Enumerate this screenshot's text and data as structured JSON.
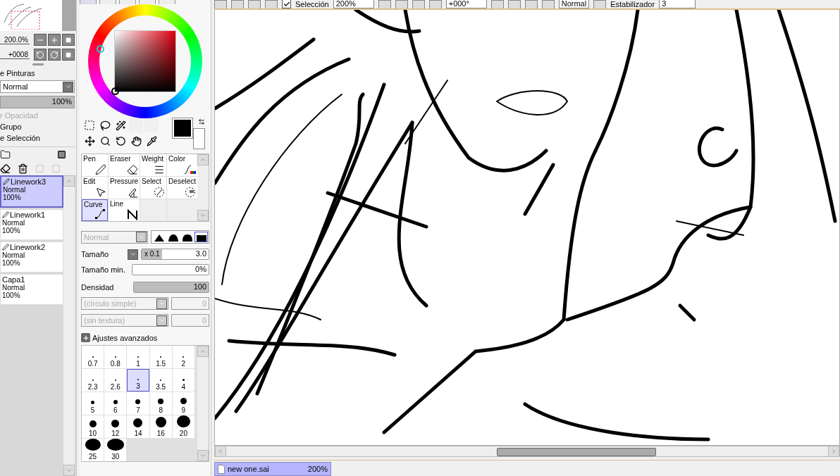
{
  "navigator": {
    "zoom": "200.0%",
    "rotation": "+0008"
  },
  "layer_panel": {
    "section_label": "e Pinturas",
    "blend_mode": "Normal",
    "opacity": {
      "text": "100%",
      "level": 1
    },
    "options": [
      {
        "label": "r Opacidad",
        "disabled": true
      },
      {
        "label": "Grupo",
        "disabled": false
      },
      {
        "label": "e Selección",
        "disabled": false
      }
    ]
  },
  "layers": [
    {
      "kind": "pen",
      "name": "Linework3",
      "mode": "Normal",
      "opacity": "100%",
      "selected": true
    },
    {
      "kind": "pen",
      "name": "Linework1",
      "mode": "Normal",
      "opacity": "100%",
      "selected": false
    },
    {
      "kind": "pen",
      "name": "Linework2",
      "mode": "Normal",
      "opacity": "100%",
      "selected": false
    },
    {
      "kind": "plain",
      "name": "Capa1",
      "mode": "Normal",
      "opacity": "100%",
      "selected": false
    }
  ],
  "tool_grid": [
    {
      "kind": "pen",
      "label": "Pen",
      "selected": false
    },
    {
      "kind": "eraser",
      "label": "Eraser",
      "selected": false
    },
    {
      "kind": "weight",
      "label": "Weight",
      "selected": false
    },
    {
      "kind": "color",
      "label": "Color",
      "selected": false
    },
    {
      "kind": "edit",
      "label": "Edit",
      "selected": false
    },
    {
      "kind": "pressure",
      "label": "Pressure",
      "selected": false
    },
    {
      "kind": "select",
      "label": "Select",
      "selected": false
    },
    {
      "kind": "deselect",
      "label": "Deselect",
      "selected": false
    },
    {
      "kind": "curve",
      "label": "Curve",
      "selected": true
    },
    {
      "kind": "line",
      "label": "Line",
      "selected": false
    }
  ],
  "brush": {
    "mode": "Normal",
    "mode_disabled": true,
    "tips": [
      {
        "selected": false
      },
      {
        "selected": false
      },
      {
        "selected": false
      },
      {
        "selected": true
      }
    ],
    "size": {
      "label": "Tamaño",
      "multiplier": "x 0.1",
      "value": "3.0",
      "level": 0.3
    },
    "min_size": {
      "label": "Tamaño min.",
      "value": "0%",
      "level": 0
    },
    "density": {
      "label": "Densidad",
      "value": "100",
      "level": 1
    },
    "shape": "(círculo simple)",
    "shape_value": "0",
    "texture": "(sin textura)",
    "texture_value": "0",
    "advanced_label": "Ajustes avanzados"
  },
  "brush_sizes": [
    {
      "label": "0.7",
      "selected": false
    },
    {
      "label": "0.8",
      "selected": false
    },
    {
      "label": "1",
      "selected": false
    },
    {
      "label": "1.5",
      "selected": false
    },
    {
      "label": "2",
      "selected": false
    },
    {
      "label": "2.3",
      "selected": false
    },
    {
      "label": "2.6",
      "selected": false
    },
    {
      "label": "3",
      "selected": true
    },
    {
      "label": "3.5",
      "selected": false
    },
    {
      "label": "4",
      "selected": false
    },
    {
      "label": "5",
      "selected": false
    },
    {
      "label": "6",
      "selected": false
    },
    {
      "label": "7",
      "selected": false
    },
    {
      "label": "8",
      "selected": false
    },
    {
      "label": "9",
      "selected": false
    },
    {
      "label": "10",
      "selected": false
    },
    {
      "label": "12",
      "selected": false
    },
    {
      "label": "14",
      "selected": false
    },
    {
      "label": "16",
      "selected": false
    },
    {
      "label": "20",
      "selected": false
    },
    {
      "label": "25",
      "selected": false
    },
    {
      "label": "30",
      "selected": false
    }
  ],
  "canvas_toolbar": {
    "selection_checked": true,
    "selection_label": "Selección",
    "zoom": "200%",
    "angle": "+000°",
    "blend": "Normal",
    "stabilizer_label": "Estabilizador",
    "stabilizer": "3"
  },
  "document_tabs": [
    {
      "name": "new one.sai",
      "zoom": "200%",
      "selected": true
    }
  ]
}
